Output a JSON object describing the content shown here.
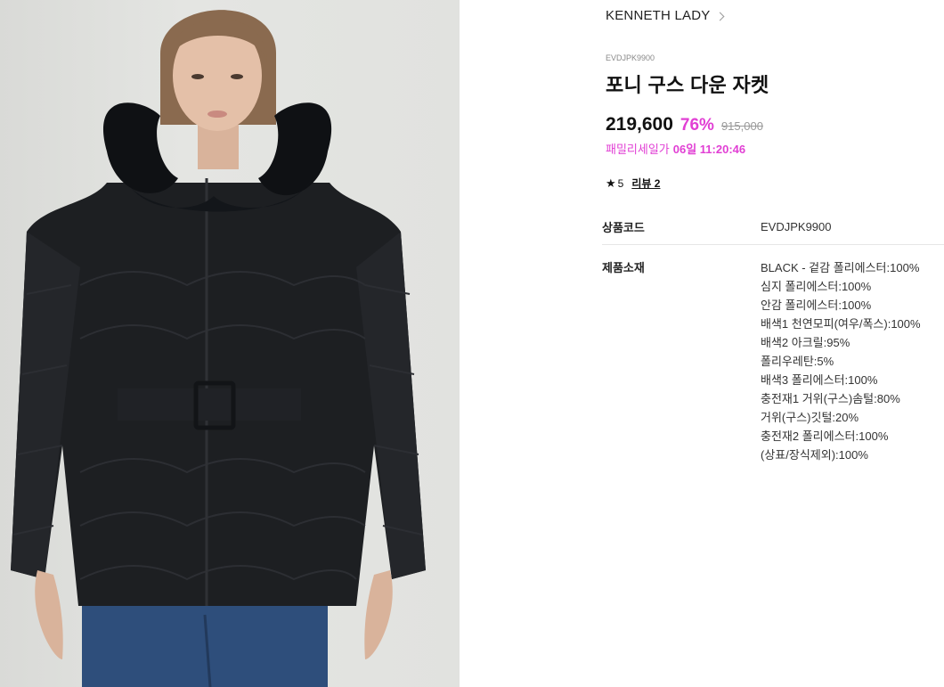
{
  "brand": {
    "name": "KENNETH LADY"
  },
  "product": {
    "sku": "EVDJPK9900",
    "title": "포니 구스 다운 자켓",
    "price_sale": "219,600",
    "discount": "76%",
    "price_original": "915,000",
    "sale_label": "패밀리세일가",
    "sale_timer": "06일 11:20:46"
  },
  "rating": {
    "score": "5",
    "review_label": "리뷰 2"
  },
  "specs": {
    "code_label": "상품코드",
    "code_value": "EVDJPK9900",
    "material_label": "제품소재",
    "materials": [
      "BLACK - 겉감 폴리에스터:100%",
      "심지 폴리에스터:100%",
      "안감 폴리에스터:100%",
      "배색1 천연모피(여우/폭스):100%",
      "배색2 아크릴:95%",
      "폴리우레탄:5%",
      "배색3 폴리에스터:100%",
      "충전재1 거위(구스)솜털:80%",
      "거위(구스)깃털:20%",
      "충전재2 폴리에스터:100%",
      "(상표/장식제외):100%"
    ]
  },
  "colors": {
    "accent": "#e13fd4",
    "jacket": "#1d1f22",
    "fur": "#0f1114",
    "background": "#e0e1de"
  },
  "icons": {
    "brand_chevron": "chevron-right-icon",
    "rating_star": "star-icon"
  }
}
